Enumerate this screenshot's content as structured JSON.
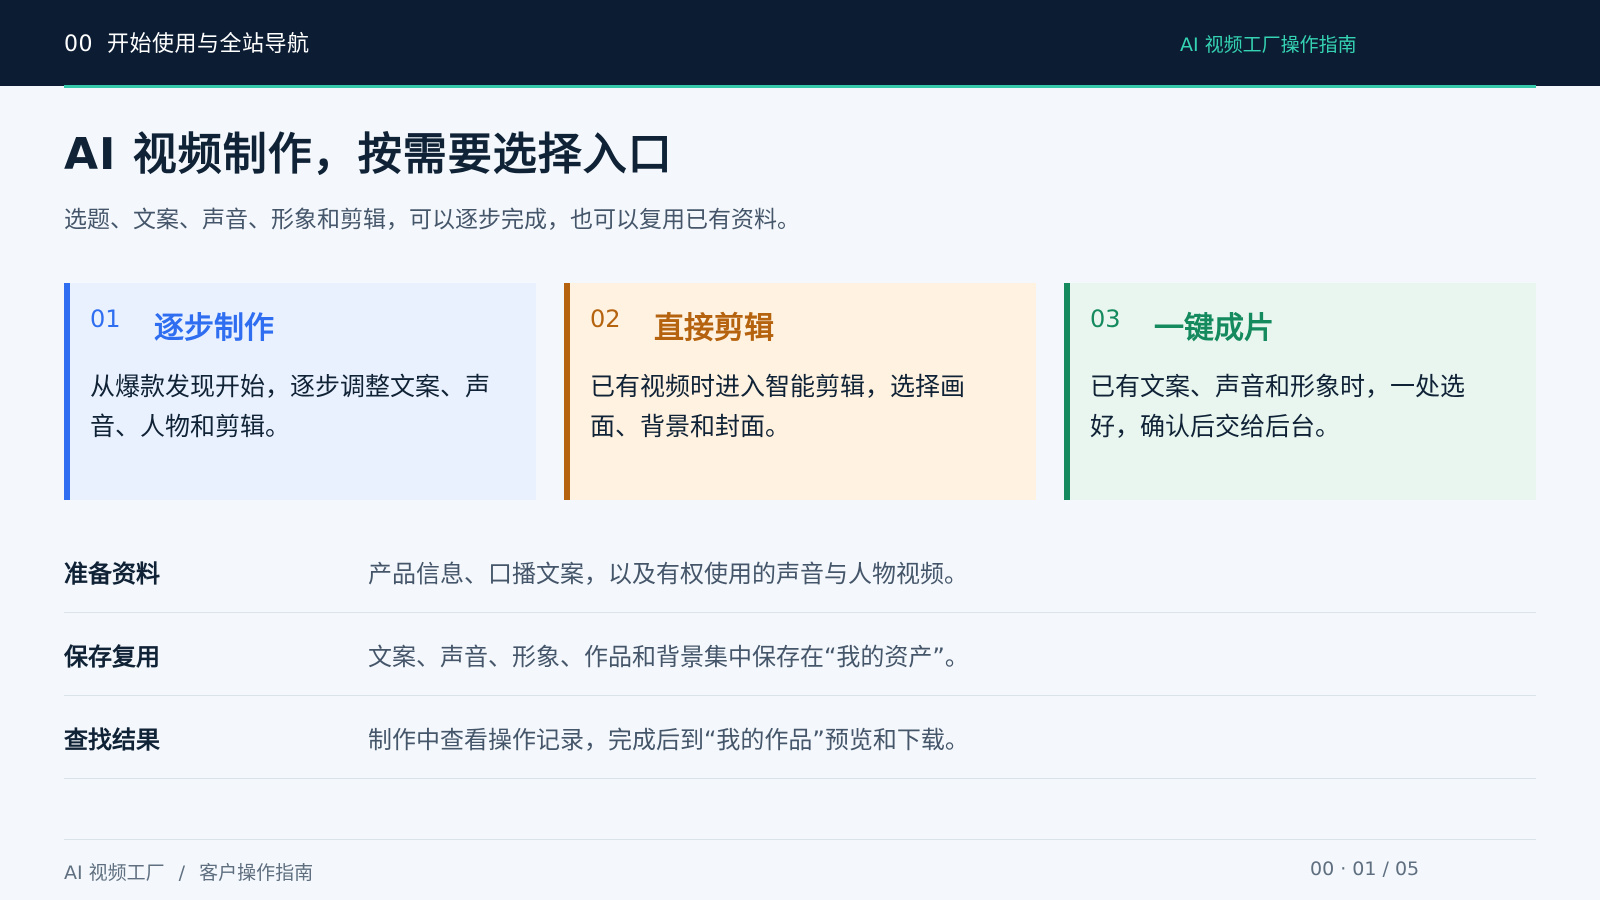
{
  "header": {
    "section_number": "00",
    "section_title": "开始使用与全站导航",
    "guide_title": "AI 视频工厂操作指南",
    "accent_color": "#35c9a9"
  },
  "main": {
    "title": "AI 视频制作，按需要选择入口",
    "subtitle": "选题、文案、声音、形象和剪辑，可以逐步完成，也可以复用已有资料。"
  },
  "cards": [
    {
      "number": "01",
      "title": "逐步制作",
      "description": "从爆款发现开始，逐步调整文案、声音、人物和剪辑。",
      "color": "#2f6ef0"
    },
    {
      "number": "02",
      "title": "直接剪辑",
      "description": "已有视频时进入智能剪辑，选择画面、背景和封面。",
      "color": "#b5630f"
    },
    {
      "number": "03",
      "title": "一键成片",
      "description": "已有文案、声音和形象时，一处选好，确认后交给后台。",
      "color": "#148a5e"
    }
  ],
  "rows": [
    {
      "label": "准备资料",
      "text": "产品信息、口播文案，以及有权使用的声音与人物视频。"
    },
    {
      "label": "保存复用",
      "text": "文案、声音、形象、作品和背景集中保存在“我的资产”。"
    },
    {
      "label": "查找结果",
      "text": "制作中查看操作记录，完成后到“我的作品”预览和下载。"
    }
  ],
  "footer": {
    "brand": "AI 视频工厂",
    "separator": "/",
    "section": "客户操作指南",
    "page_indicator": "00 · 01 / 05"
  }
}
